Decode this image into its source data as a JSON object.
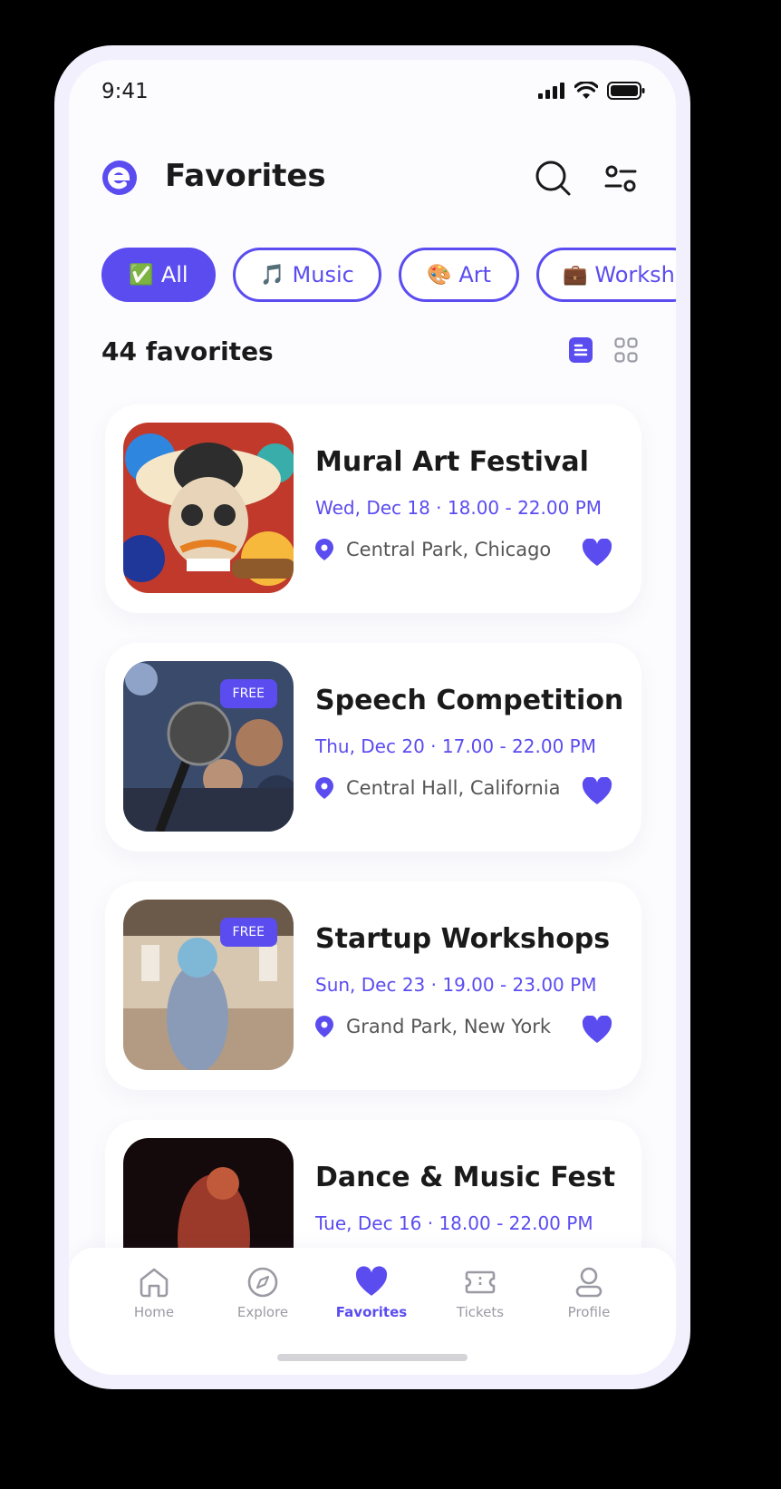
{
  "status_bar": {
    "time": "9:41"
  },
  "header": {
    "title": "Favorites"
  },
  "filters": [
    {
      "emoji": "✅",
      "label": "All",
      "active": true
    },
    {
      "emoji": "🎵",
      "label": "Music",
      "active": false
    },
    {
      "emoji": "🎨",
      "label": "Art",
      "active": false
    },
    {
      "emoji": "💼",
      "label": "Worksho",
      "active": false
    }
  ],
  "favorites_count": "44 favorites",
  "events": [
    {
      "title": "Mural Art Festival",
      "date": "Wed, Dec 18 · 18.00 - 22.00 PM",
      "location": "Central Park, Chicago",
      "badge": ""
    },
    {
      "title": "Speech Competition",
      "date": "Thu, Dec 20 · 17.00 - 22.00 PM",
      "location": "Central Hall, California",
      "badge": "FREE"
    },
    {
      "title": "Startup Workshops",
      "date": "Sun, Dec 23 · 19.00 - 23.00 PM",
      "location": "Grand Park, New York",
      "badge": "FREE"
    },
    {
      "title": "Dance & Music Fest",
      "date": "Tue, Dec 16 · 18.00 - 22.00 PM",
      "location": "",
      "badge": ""
    }
  ],
  "nav": [
    {
      "label": "Home",
      "icon": "home-icon"
    },
    {
      "label": "Explore",
      "icon": "compass-icon"
    },
    {
      "label": "Favorites",
      "icon": "heart-icon"
    },
    {
      "label": "Tickets",
      "icon": "ticket-icon"
    },
    {
      "label": "Profile",
      "icon": "user-icon"
    }
  ],
  "theme": {
    "accent": "#5B4CF0",
    "text": "#1A1A1A"
  }
}
